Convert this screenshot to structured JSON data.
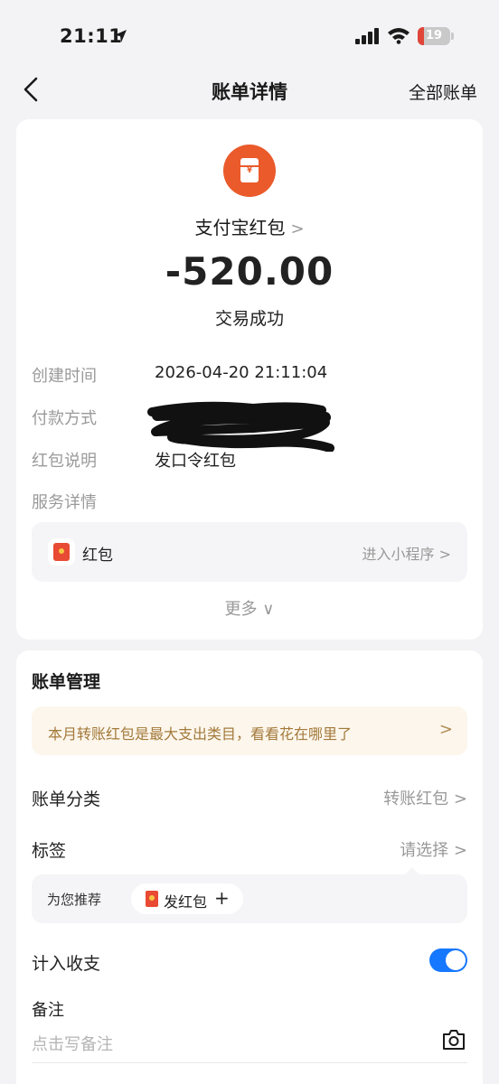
{
  "status_bar": {
    "time": "21:11",
    "battery_level": "19",
    "battery_fraction": 0.19,
    "location_icon": "location-arrow-icon",
    "signal_icon": "cellular-signal-icon",
    "wifi_icon": "wifi-icon"
  },
  "nav": {
    "title": "账单详情",
    "right_link": "全部账单",
    "back_icon": "chevron-left-icon"
  },
  "detail": {
    "merchant_name": "支付宝红包",
    "merchant_chevron": ">",
    "amount": "-520.00",
    "status": "交易成功",
    "rows": [
      {
        "label": "创建时间",
        "value": "2026-04-20 21:11:04"
      },
      {
        "label": "付款方式",
        "value": ""
      },
      {
        "label": "红包说明",
        "value": "发口令红包"
      },
      {
        "label": "服务详情",
        "value": ""
      }
    ],
    "service": {
      "label": "红包",
      "link": "进入小程序 >"
    },
    "more": "更多 ∨"
  },
  "manage": {
    "title": "账单管理",
    "tip": "本月转账红包是最大支出类目，看看花在哪里了",
    "tip_chevron": ">",
    "category_label": "账单分类",
    "category_value": "转账红包 >",
    "tag_label": "标签",
    "tag_value": "请选择 >",
    "recommend_label": "为您推荐",
    "recommend_chip": "发红包",
    "recommend_plus": "+",
    "include_label": "计入收支",
    "include_on": true,
    "note_label": "备注",
    "note_placeholder": "点击写备注"
  },
  "colors": {
    "accent": "#1677ff",
    "logo": "#ea5a2a",
    "red_packet": "#e84a33",
    "tip_text": "#a3793a"
  }
}
